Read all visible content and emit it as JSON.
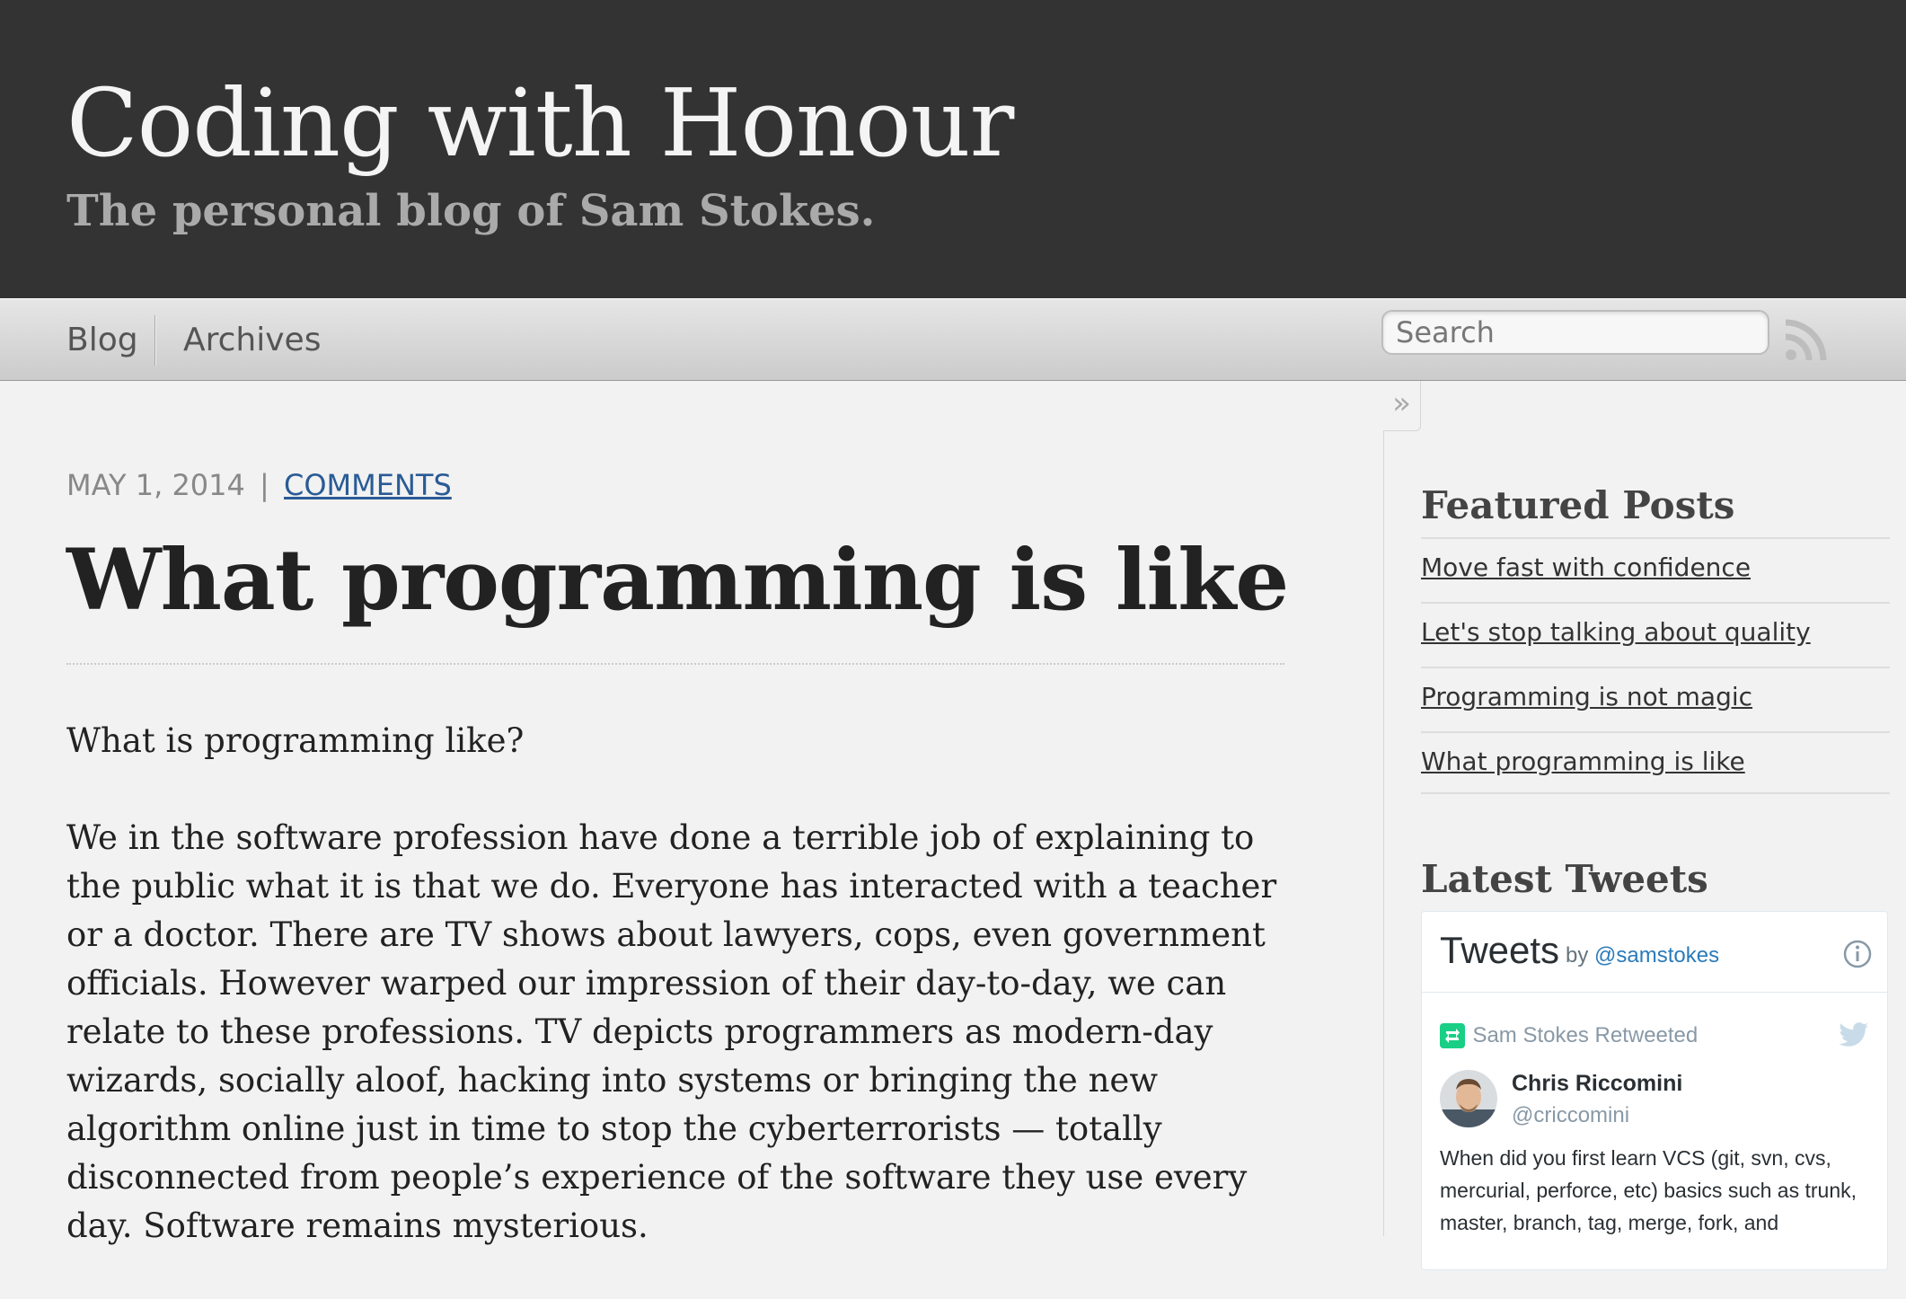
{
  "header": {
    "site_title": "Coding with Honour",
    "site_subtitle": "The personal blog of Sam Stokes."
  },
  "nav": {
    "items": [
      {
        "label": "Blog"
      },
      {
        "label": "Archives"
      }
    ],
    "search_placeholder": "Search",
    "rss_icon": "rss-icon"
  },
  "post": {
    "date": "MAY 1, 2014",
    "separator": "|",
    "comments_label": "COMMENTS",
    "title": "What programming is like",
    "paragraphs": [
      "What is programming like?",
      "We in the software profession have done a terrible job of explaining to the public what it is that we do. Everyone has interacted with a teacher or a doctor. There are TV shows about lawyers, cops, even government officials. However warped our impression of their day-to-day, we can relate to these professions. TV depicts programmers as modern-day wizards, socially aloof, hacking into systems or bringing the new algorithm online just in time to stop the cyberterrorists — totally disconnected from people’s experience of the software they use every day. Software remains mysterious."
    ]
  },
  "sidebar": {
    "toggle_glyph": "»",
    "featured_heading": "Featured Posts",
    "featured_posts": [
      {
        "label": "Move fast with confidence"
      },
      {
        "label": "Let's stop talking about quality"
      },
      {
        "label": "Programming is not magic"
      },
      {
        "label": "What programming is like"
      }
    ],
    "tweets_heading": "Latest Tweets",
    "tweet_widget": {
      "title": "Tweets",
      "by_label": "by",
      "handle": "@samstokes",
      "retweeted_label": "Sam Stokes Retweeted",
      "tweet": {
        "author_name": "Chris Riccomini",
        "author_handle": "@criccomini",
        "text": "When did you first learn VCS (git, svn, cvs, mercurial, perforce, etc) basics such as trunk, master, branch, tag, merge, fork, and"
      }
    }
  },
  "colors": {
    "header_bg": "#333333",
    "link_blue": "#2a5b96",
    "twitter_blue": "#2b7bb9",
    "retweet_green": "#19cf86"
  }
}
